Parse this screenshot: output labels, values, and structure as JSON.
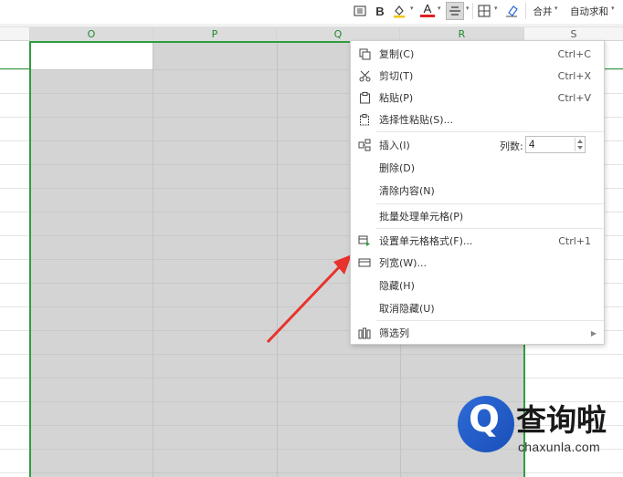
{
  "toolbar": {
    "bold_label": "B",
    "font_color_label": "A",
    "merge_label": "合并",
    "autosum_label": "自动求和"
  },
  "columns": [
    {
      "letter": "O"
    },
    {
      "letter": "P"
    },
    {
      "letter": "Q"
    },
    {
      "letter": "R"
    },
    {
      "letter": "S"
    }
  ],
  "context_menu": {
    "copy": {
      "label": "复制(C)",
      "shortcut": "Ctrl+C"
    },
    "cut": {
      "label": "剪切(T)",
      "shortcut": "Ctrl+X"
    },
    "paste": {
      "label": "粘贴(P)",
      "shortcut": "Ctrl+V"
    },
    "paste_special": {
      "label": "选择性粘贴(S)..."
    },
    "insert": {
      "label": "插入(I)",
      "cols_label": "列数:",
      "cols_value": "4"
    },
    "delete": {
      "label": "删除(D)"
    },
    "clear_contents": {
      "label": "清除内容(N)"
    },
    "batch_process": {
      "label": "批量处理单元格(P)"
    },
    "format_cells": {
      "label": "设置单元格格式(F)...",
      "shortcut": "Ctrl+1"
    },
    "column_width": {
      "label": "列宽(W)..."
    },
    "hide": {
      "label": "隐藏(H)"
    },
    "unhide": {
      "label": "取消隐藏(U)"
    },
    "filter_columns": {
      "label": "筛选列"
    }
  },
  "watermark": {
    "logo_letter": "Q",
    "brand": "查询啦",
    "url": "chaxunla.com"
  },
  "colors": {
    "selection_green": "#2f9c3e",
    "arrow_red": "#e8322d",
    "brand_blue": "#2e6bd9"
  }
}
